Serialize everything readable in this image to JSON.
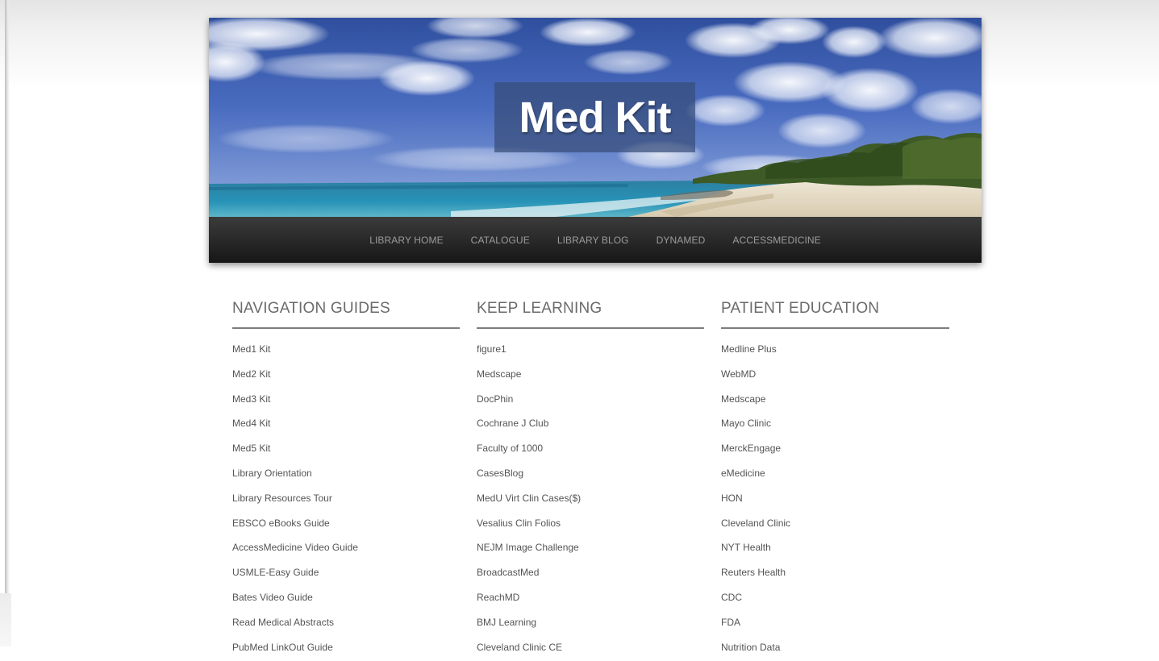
{
  "header": {
    "site_title": "Med Kit"
  },
  "nav": {
    "items": [
      {
        "label": "LIBRARY HOME"
      },
      {
        "label": "CATALOGUE"
      },
      {
        "label": "LIBRARY BLOG"
      },
      {
        "label": "DYNAMED"
      },
      {
        "label": "ACCESSMEDICINE"
      }
    ]
  },
  "columns": [
    {
      "title": "NAVIGATION GUIDES",
      "links": [
        "Med1 Kit",
        "Med2 Kit",
        "Med3 Kit",
        "Med4 Kit",
        "Med5 Kit",
        "Library Orientation",
        "Library Resources Tour",
        "EBSCO eBooks Guide",
        "AccessMedicine Video Guide",
        "USMLE-Easy Guide",
        "Bates Video Guide",
        "Read Medical Abstracts",
        "PubMed LinkOut Guide"
      ]
    },
    {
      "title": "KEEP LEARNING",
      "links": [
        "figure1",
        "Medscape",
        "DocPhin",
        "Cochrane J Club",
        "Faculty of 1000",
        "CasesBlog",
        "MedU Virt Clin Cases($)",
        "Vesalius Clin Folios",
        "NEJM Image Challenge",
        "BroadcastMed",
        "ReachMD",
        "BMJ Learning",
        "Cleveland Clinic CE"
      ]
    },
    {
      "title": "PATIENT EDUCATION",
      "links": [
        "Medline Plus",
        "WebMD",
        "Medscape",
        "Mayo Clinic",
        "MerckEngage",
        "eMedicine",
        "HON",
        "Cleveland Clinic",
        "NYT Health",
        "Reuters Health",
        "CDC",
        "FDA",
        "Nutrition Data"
      ]
    }
  ]
}
